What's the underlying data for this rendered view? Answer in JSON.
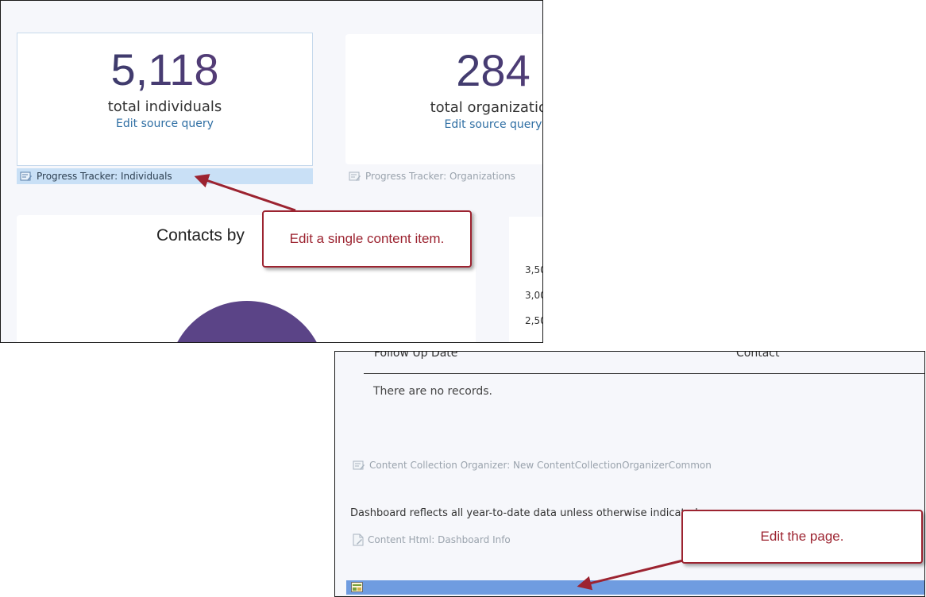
{
  "stats": [
    {
      "value": "5,118",
      "label": "total individuals",
      "link": "Edit source query",
      "tracker": "Progress Tracker: Individuals"
    },
    {
      "value": "284",
      "label": "total organization",
      "link": "Edit source query",
      "tracker": "Progress Tracker: Organizations"
    }
  ],
  "chart": {
    "title": "Contacts by",
    "pie_color": "#5b4487",
    "y_ticks": [
      "3,50",
      "3,00",
      "2,50"
    ]
  },
  "table": {
    "columns": [
      "Follow Up Date",
      "Contact"
    ],
    "empty_message": "There are no records."
  },
  "parts": {
    "collection_organizer": "Content Collection Organizer: New ContentCollectionOrganizerCommon",
    "dashboard_info_text": "Dashboard reflects all year-to-date data unless otherwise indicated.",
    "content_html": "Content Html: Dashboard Info"
  },
  "callouts": {
    "item": "Edit a single content item.",
    "page": "Edit the page."
  },
  "colors": {
    "accent_red": "#9c2330",
    "tracker_selected": "#c9e0f6",
    "page_bar": "#6f9ce0",
    "link": "#2e6ea3"
  }
}
